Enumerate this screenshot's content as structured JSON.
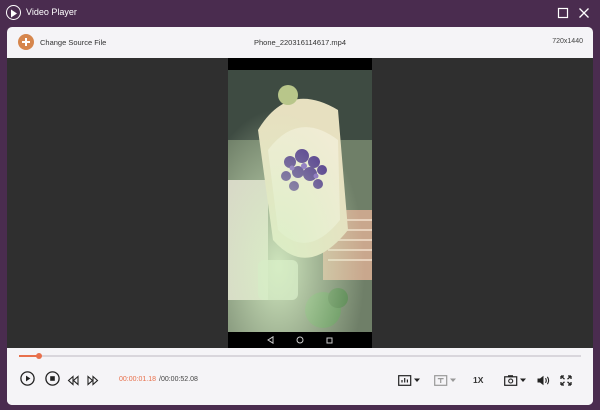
{
  "window": {
    "title": "Video Player"
  },
  "toolbar": {
    "change_source_label": "Change Source File",
    "file_name": "Phone_220316114617.mp4",
    "resolution": "720x1440"
  },
  "playback": {
    "current_time": "00:00:01.18",
    "total_time": "/00:00:52.08",
    "progress_percent": 3.6,
    "speed_label": "1X"
  },
  "colors": {
    "accent": "#e8704c",
    "window_background": "#4a2c4f",
    "add_button": "#d6864d"
  },
  "icons": {
    "app": "play-circle-icon",
    "maximize": "maximize-icon",
    "close": "close-icon",
    "add": "plus-circle-icon",
    "play": "play-icon",
    "stop": "stop-icon",
    "previous": "rewind-icon",
    "next": "fast-forward-icon",
    "audio_track": "audio-track-icon",
    "subtitle": "subtitle-icon",
    "snapshot": "camera-icon",
    "volume": "volume-icon",
    "fullscreen": "fullscreen-icon"
  }
}
